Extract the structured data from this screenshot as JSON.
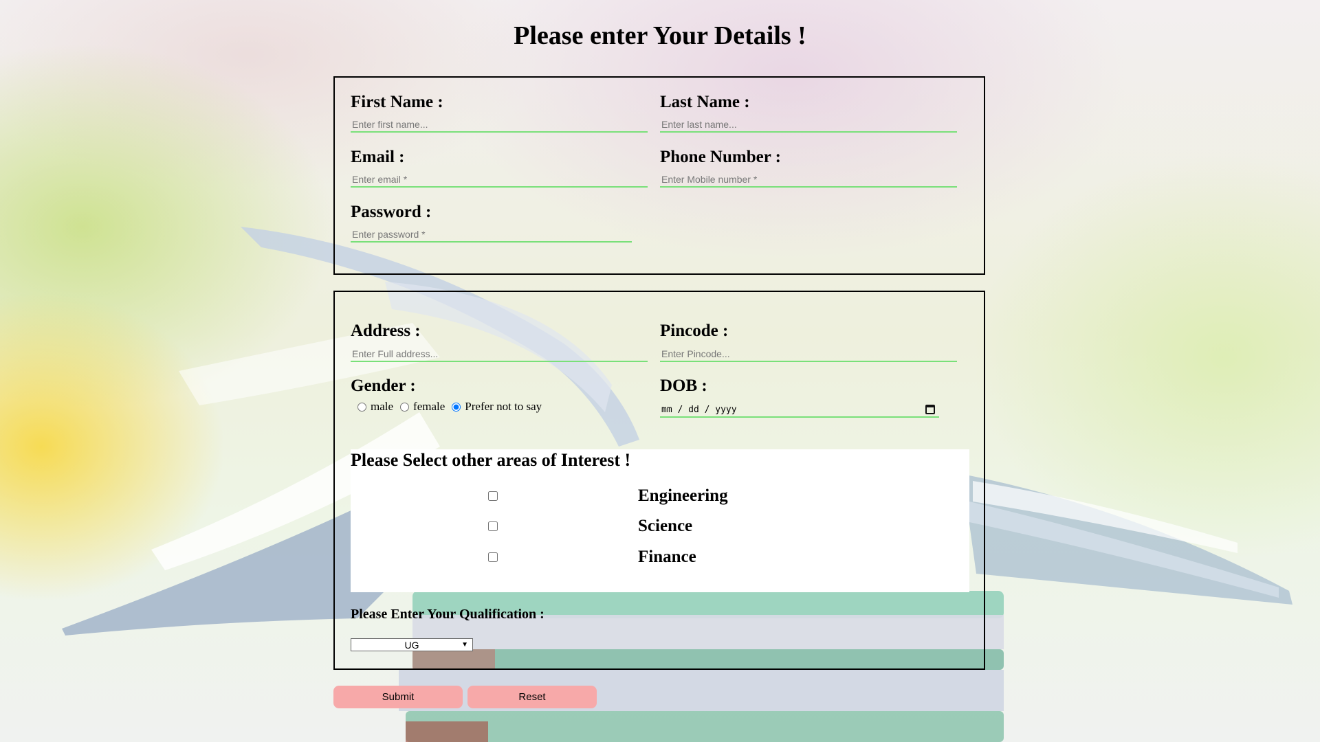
{
  "page": {
    "title": "Please enter Your Details !"
  },
  "colors": {
    "field_underline": "#79e079",
    "button_bg": "#f7a9a9",
    "panel_bg": "#ffffff"
  },
  "personal": {
    "first_name": {
      "label": "First Name :",
      "value": "",
      "placeholder": "Enter first name..."
    },
    "last_name": {
      "label": "Last Name :",
      "value": "",
      "placeholder": "Enter last name..."
    },
    "email": {
      "label": "Email :",
      "value": "",
      "placeholder": "Enter email *"
    },
    "phone": {
      "label": "Phone Number :",
      "value": "",
      "placeholder": "Enter Mobile number *"
    },
    "password": {
      "label": "Password :",
      "value": "",
      "placeholder": "Enter password *"
    }
  },
  "address_block": {
    "address": {
      "label": "Address :",
      "value": "",
      "placeholder": "Enter Full address..."
    },
    "pincode": {
      "label": "Pincode :",
      "value": "",
      "placeholder": "Enter Pincode..."
    },
    "gender": {
      "label": "Gender :",
      "options": [
        "male",
        "female",
        "Prefer not to say"
      ],
      "selected": "Prefer not to say"
    },
    "dob": {
      "label": "DOB :",
      "value": "mm / dd / yyyy",
      "icon": "calendar-icon"
    }
  },
  "interests": {
    "heading": "Please Select other areas of Interest !",
    "items": [
      {
        "label": "Engineering",
        "checked": false
      },
      {
        "label": "Science",
        "checked": false
      },
      {
        "label": "Finance",
        "checked": false
      }
    ]
  },
  "qualification": {
    "label": "Please Enter Your Qualification :",
    "selected": "UG",
    "icon": "chevron-down-icon"
  },
  "buttons": {
    "submit": "Submit",
    "reset": "Reset"
  }
}
